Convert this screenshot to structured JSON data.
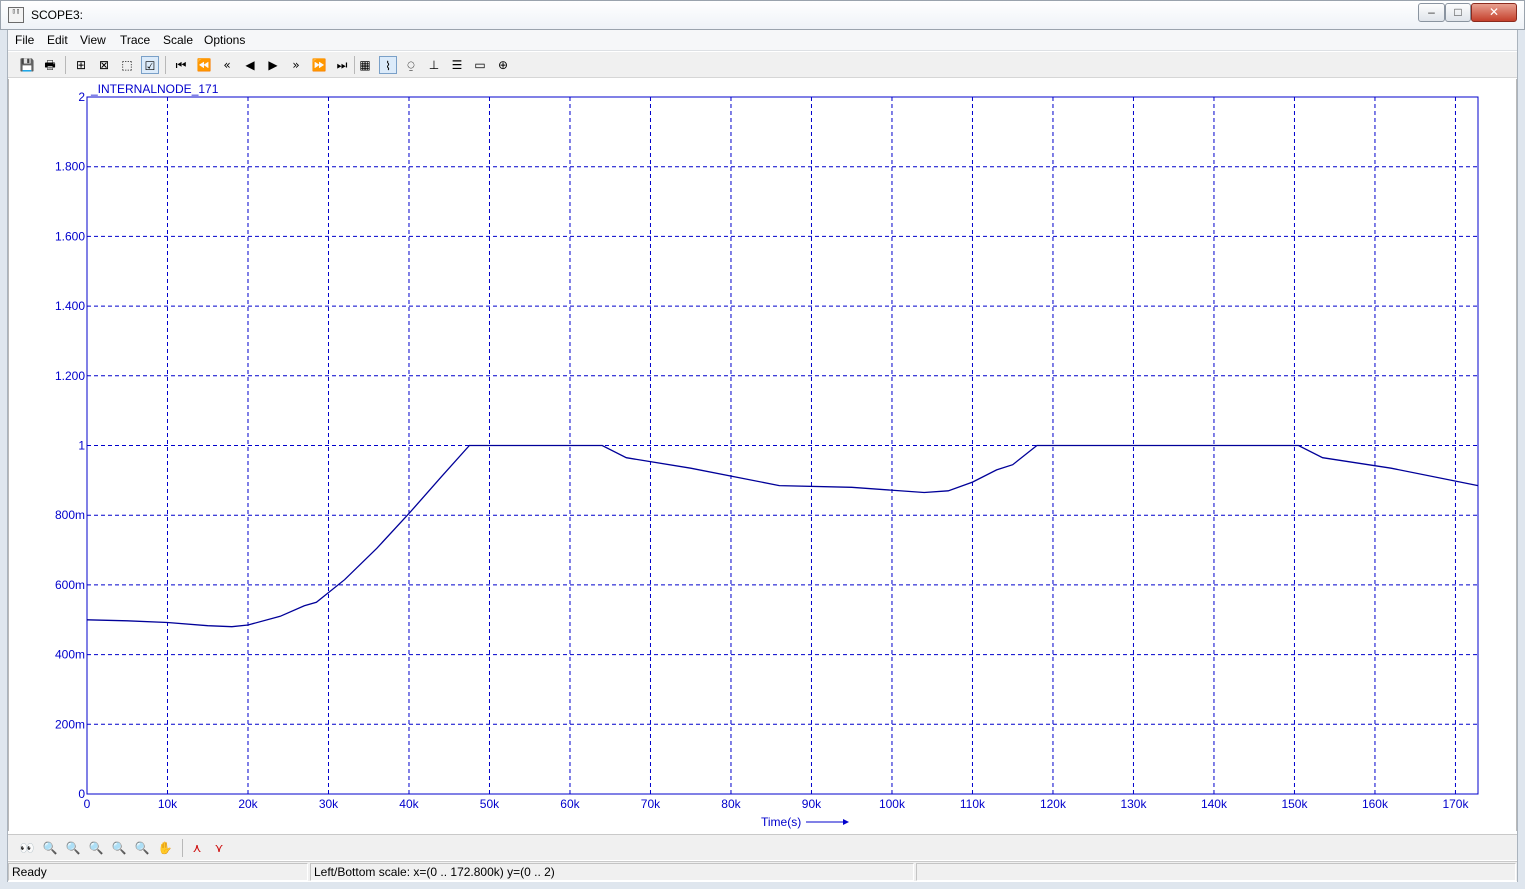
{
  "window": {
    "title": "SCOPE3:",
    "minimize": "–",
    "maximize": "□",
    "close": "✕"
  },
  "menu": [
    "File",
    "Edit",
    "View",
    "Trace",
    "Scale",
    "Options"
  ],
  "toolbar": [
    {
      "name": "save-icon",
      "glyph": "💾"
    },
    {
      "name": "print-icon",
      "glyph": "🖶"
    },
    {
      "name": "cursor-icon",
      "glyph": "⊞"
    },
    {
      "name": "zoom-fit-icon",
      "glyph": "⊠"
    },
    {
      "name": "select-rect-icon",
      "glyph": "⬚"
    },
    {
      "name": "check-icon",
      "glyph": "☑"
    },
    {
      "name": "go-first-icon",
      "glyph": "⏮"
    },
    {
      "name": "rewind-fast-icon",
      "glyph": "⏪"
    },
    {
      "name": "rewind-icon",
      "glyph": "«"
    },
    {
      "name": "step-back-icon",
      "glyph": "◀"
    },
    {
      "name": "play-icon",
      "glyph": "▶"
    },
    {
      "name": "forward-icon",
      "glyph": "»"
    },
    {
      "name": "forward-fast-icon",
      "glyph": "⏩"
    },
    {
      "name": "go-last-icon",
      "glyph": "⏭"
    },
    {
      "name": "table-icon",
      "glyph": "▦"
    },
    {
      "name": "trace-line-icon",
      "glyph": "⌇"
    },
    {
      "name": "trace-marker-icon",
      "glyph": "⍜"
    },
    {
      "name": "axis-icon",
      "glyph": "⊥"
    },
    {
      "name": "list-icon",
      "glyph": "☰"
    },
    {
      "name": "window-icon",
      "glyph": "▭"
    },
    {
      "name": "target-icon",
      "glyph": "⊕"
    }
  ],
  "bottom_tools": [
    {
      "name": "binoculars-icon",
      "glyph": "👀"
    },
    {
      "name": "zoom-icon",
      "glyph": "🔍"
    },
    {
      "name": "zoom-x-icon",
      "glyph": "🔍"
    },
    {
      "name": "zoom-y-icon",
      "glyph": "🔍"
    },
    {
      "name": "zoom-in-icon",
      "glyph": "🔍"
    },
    {
      "name": "zoom-out-icon",
      "glyph": "🔍"
    },
    {
      "name": "pan-hand-icon",
      "glyph": "✋"
    },
    {
      "name": "cursor-up-icon",
      "glyph": "⋏"
    },
    {
      "name": "cursor-down-icon",
      "glyph": "⋎"
    }
  ],
  "status": {
    "ready": "Ready",
    "scale": "Left/Bottom scale:  x=(0 ..  172.800k) y=(0 ..  2)"
  },
  "colors": {
    "grid": "#0000cc",
    "trace": "#000099",
    "axis_text": "#0000cc"
  },
  "chart_data": {
    "type": "line",
    "title": "",
    "series": [
      {
        "name": "_INTERNALNODE_171",
        "x": [
          0,
          5000,
          10000,
          15000,
          18000,
          20000,
          24000,
          27000,
          28500,
          32000,
          36000,
          40000,
          44000,
          47500,
          55000,
          64000,
          67000,
          75000,
          86000,
          95000,
          104000,
          107000,
          110000,
          113000,
          115000,
          118000,
          130000,
          150500,
          153500,
          162000,
          172800
        ],
        "y": [
          0.5,
          0.497,
          0.492,
          0.483,
          0.48,
          0.485,
          0.51,
          0.54,
          0.55,
          0.615,
          0.705,
          0.805,
          0.91,
          1.0,
          1.0,
          1.0,
          0.965,
          0.935,
          0.885,
          0.88,
          0.865,
          0.87,
          0.895,
          0.93,
          0.945,
          1.0,
          1.0,
          1.0,
          0.965,
          0.935,
          0.885
        ]
      }
    ],
    "xlabel": "Time(s)",
    "ylabel": "",
    "xlim": [
      0,
      172800
    ],
    "ylim": [
      0,
      2
    ],
    "x_ticks": [
      {
        "v": 0,
        "label": "0"
      },
      {
        "v": 10000,
        "label": "10k"
      },
      {
        "v": 20000,
        "label": "20k"
      },
      {
        "v": 30000,
        "label": "30k"
      },
      {
        "v": 40000,
        "label": "40k"
      },
      {
        "v": 50000,
        "label": "50k"
      },
      {
        "v": 60000,
        "label": "60k"
      },
      {
        "v": 70000,
        "label": "70k"
      },
      {
        "v": 80000,
        "label": "80k"
      },
      {
        "v": 90000,
        "label": "90k"
      },
      {
        "v": 100000,
        "label": "100k"
      },
      {
        "v": 110000,
        "label": "110k"
      },
      {
        "v": 120000,
        "label": "120k"
      },
      {
        "v": 130000,
        "label": "130k"
      },
      {
        "v": 140000,
        "label": "140k"
      },
      {
        "v": 150000,
        "label": "150k"
      },
      {
        "v": 160000,
        "label": "160k"
      },
      {
        "v": 170000,
        "label": "170k"
      }
    ],
    "y_ticks": [
      {
        "v": 0,
        "label": "0"
      },
      {
        "v": 0.2,
        "label": "200m"
      },
      {
        "v": 0.4,
        "label": "400m"
      },
      {
        "v": 0.6,
        "label": "600m"
      },
      {
        "v": 0.8,
        "label": "800m"
      },
      {
        "v": 1.0,
        "label": "1"
      },
      {
        "v": 1.2,
        "label": "1.200"
      },
      {
        "v": 1.4,
        "label": "1.400"
      },
      {
        "v": 1.6,
        "label": "1.600"
      },
      {
        "v": 1.8,
        "label": "1.800"
      },
      {
        "v": 2.0,
        "label": "2"
      }
    ],
    "grid": true,
    "legend": "top-left"
  }
}
